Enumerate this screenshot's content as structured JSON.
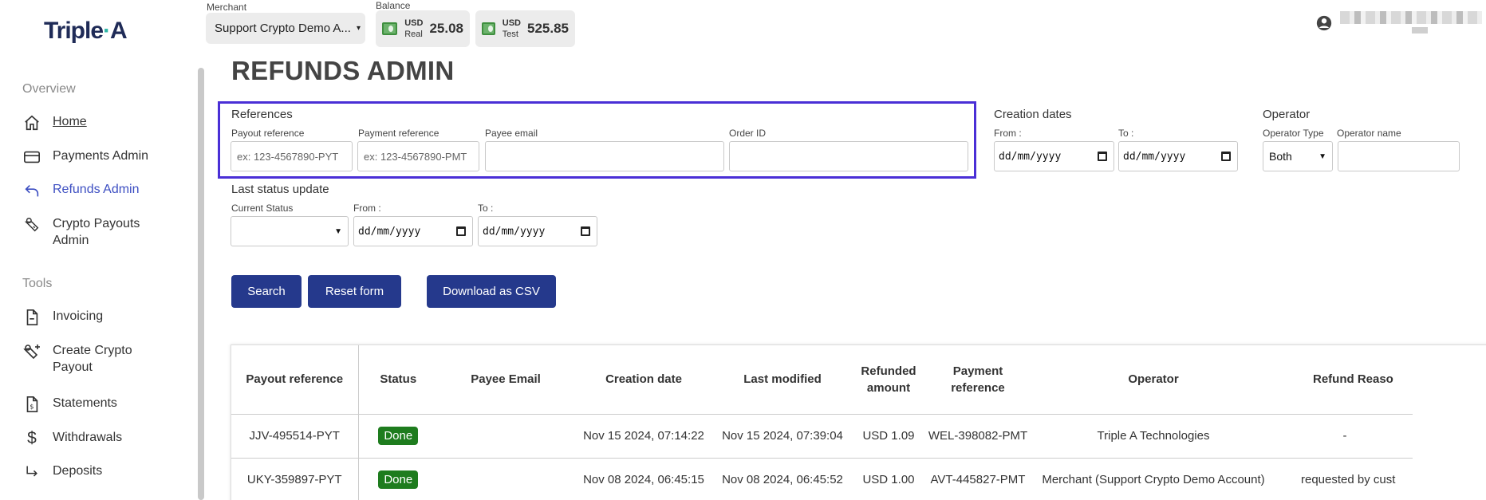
{
  "brand": {
    "name_left": "Triple",
    "name_dot": "·",
    "name_right": "A"
  },
  "sidebar": {
    "overview_title": "Overview",
    "tools_title": "Tools",
    "items": [
      {
        "label": "Home"
      },
      {
        "label": "Payments Admin"
      },
      {
        "label": "Refunds Admin"
      },
      {
        "label": "Crypto Payouts Admin"
      },
      {
        "label": "Invoicing"
      },
      {
        "label": "Create Crypto Payout"
      },
      {
        "label": "Statements"
      },
      {
        "label": "Withdrawals"
      },
      {
        "label": "Deposits"
      }
    ]
  },
  "topbar": {
    "merchant_label": "Merchant",
    "merchant_value": "Support Crypto Demo A...",
    "balance_label": "Balance",
    "balances": [
      {
        "currency": "USD",
        "kind": "Real",
        "amount": "25.08"
      },
      {
        "currency": "USD",
        "kind": "Test",
        "amount": "525.85"
      }
    ]
  },
  "page": {
    "title": "REFUNDS ADMIN",
    "references": {
      "title": "References",
      "payout_label": "Payout reference",
      "payout_placeholder": "ex: 123-4567890-PYT",
      "payment_label": "Payment reference",
      "payment_placeholder": "ex: 123-4567890-PMT",
      "email_label": "Payee email",
      "order_label": "Order ID"
    },
    "creation": {
      "title": "Creation dates",
      "from_label": "From :",
      "to_label": "To :",
      "from_value": "dd/mm/yyyy",
      "to_value": "dd/mm/yyyy"
    },
    "operator": {
      "title": "Operator",
      "type_label": "Operator Type",
      "type_value": "Both",
      "name_label": "Operator name"
    },
    "last_status": {
      "title": "Last status update",
      "status_label": "Current Status",
      "from_label": "From :",
      "to_label": "To :",
      "from_value": "dd/mm/yyyy",
      "to_value": "dd/mm/yyyy"
    },
    "buttons": {
      "search": "Search",
      "reset": "Reset form",
      "download": "Download as CSV"
    }
  },
  "table": {
    "headers": [
      "Payout reference",
      "Status",
      "Payee Email",
      "Creation date",
      "Last modified",
      "Refunded amount",
      "Payment reference",
      "Operator",
      "Refund Reaso"
    ],
    "rows": [
      [
        "JJV-495514-PYT",
        "Done",
        "",
        "Nov 15 2024, 07:14:22",
        "Nov 15 2024, 07:39:04",
        "USD 1.09",
        "WEL-398082-PMT",
        "Triple A Technologies",
        "-"
      ],
      [
        "UKY-359897-PYT",
        "Done",
        "",
        "Nov 08 2024, 06:45:15",
        "Nov 08 2024, 06:45:52",
        "USD 1.00",
        "AVT-445827-PMT",
        "Merchant (Support Crypto Demo Account)",
        "requested by cust"
      ]
    ]
  }
}
